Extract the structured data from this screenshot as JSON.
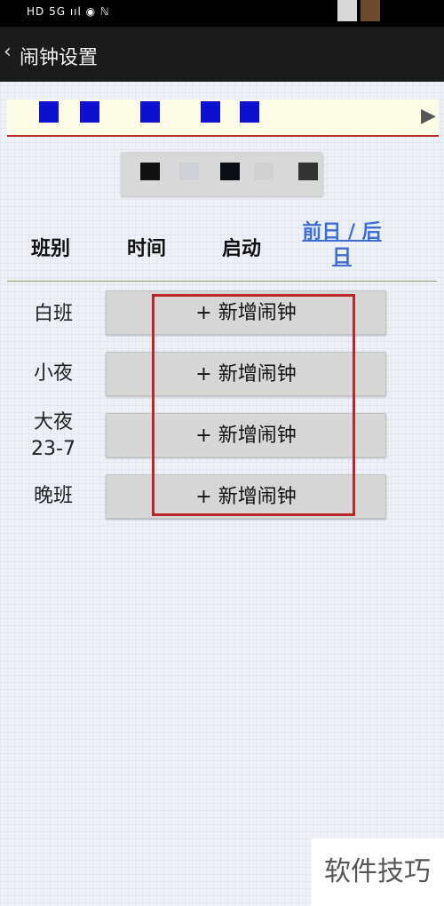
{
  "status_bar": {
    "icons": "HD 5G ııl ◉ ℕ"
  },
  "title_bar": {
    "back_icon": "‹",
    "title": "闹钟设置"
  },
  "notice": {
    "text": ""
  },
  "header": {
    "col_shift": "班别",
    "col_time": "时间",
    "col_enable": "启动",
    "col_prevnext": "前日 / 后日"
  },
  "rows": [
    {
      "shift": "白班",
      "button": "+ 新增闹钟"
    },
    {
      "shift": "小夜",
      "button": "+ 新增闹钟"
    },
    {
      "shift": "大夜\n23-7",
      "button": "+ 新增闹钟"
    },
    {
      "shift": "晚班",
      "button": "+ 新增闹钟"
    }
  ],
  "watermark": "软件技巧",
  "colors": {
    "highlight_border": "#b9262a",
    "link": "#3b6fd4",
    "banner_line": "#c0292b"
  }
}
